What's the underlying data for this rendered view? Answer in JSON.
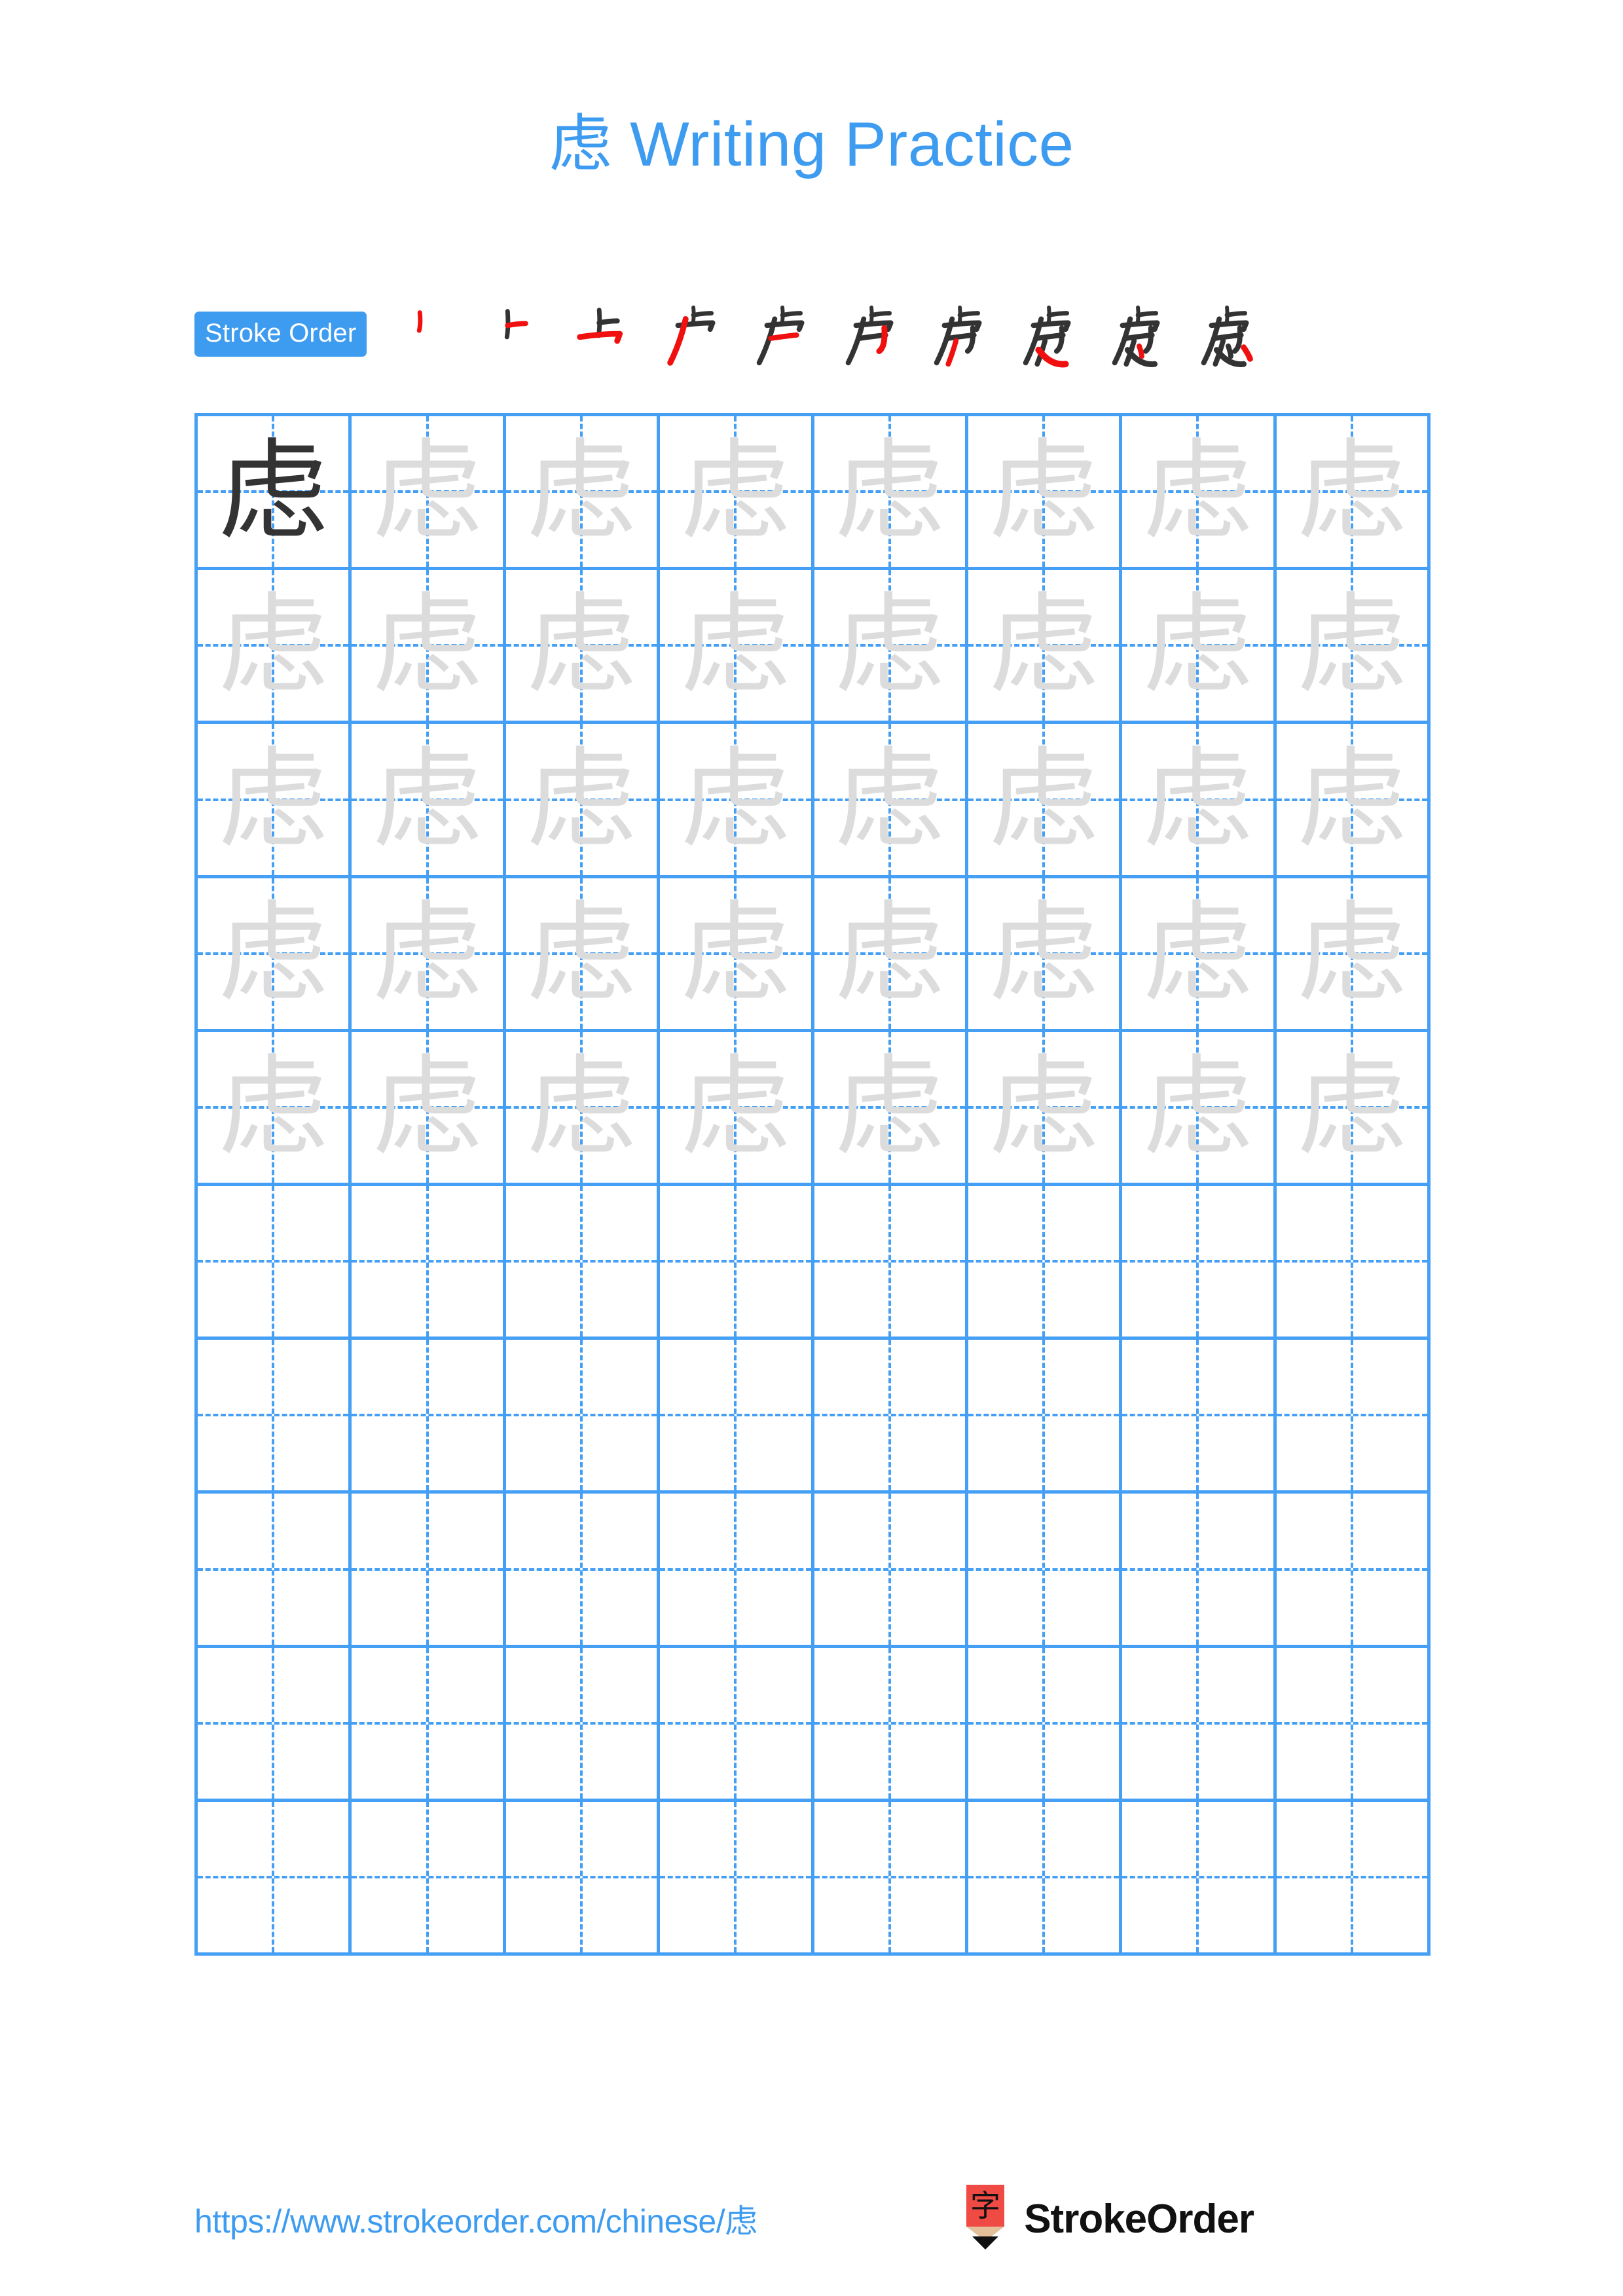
{
  "page": {
    "background": "#ffffff",
    "accent_blue": "#3d9bf0",
    "grid_blue": "#45a0f5",
    "dark_ink": "#333333",
    "faint_ink": "#dcdcdc",
    "stroke_highlight_red": "#f01010",
    "logo_red": "#ef4a43",
    "logo_tan": "#e3c09a"
  },
  "title": {
    "character": "虑",
    "text": " Writing Practice",
    "full": "虑 Writing Practice"
  },
  "stroke_order": {
    "badge_label": "Stroke Order",
    "character": "虑",
    "total_strokes": 10,
    "steps": [
      {
        "index": 1,
        "partial": "丶",
        "new_stroke": "dot"
      },
      {
        "index": 2,
        "partial": "⺊",
        "new_stroke": "horizontal"
      },
      {
        "index": 3,
        "partial": "上",
        "new_stroke": "horizontal"
      },
      {
        "index": 4,
        "partial": "广",
        "new_stroke": "left-falling"
      },
      {
        "index": 5,
        "partial": "卢",
        "new_stroke": "horizontal"
      },
      {
        "index": 6,
        "partial": "虍",
        "new_stroke": "vertical-hook"
      },
      {
        "index": 7,
        "partial": "虍",
        "new_stroke": "left-falling"
      },
      {
        "index": 8,
        "partial": "虑",
        "new_stroke": "slanted-hook"
      },
      {
        "index": 9,
        "partial": "虑",
        "new_stroke": "dot"
      },
      {
        "index": 10,
        "partial": "虑",
        "new_stroke": "dot"
      }
    ]
  },
  "grid": {
    "character": "虑",
    "columns": 8,
    "rows": 10,
    "filled_rows": 5,
    "empty_rows": 5,
    "guide_style": "dashed-crosshair",
    "rows_data": [
      {
        "row": 1,
        "cells": [
          "dark",
          "faint",
          "faint",
          "faint",
          "faint",
          "faint",
          "faint",
          "faint"
        ]
      },
      {
        "row": 2,
        "cells": [
          "faint",
          "faint",
          "faint",
          "faint",
          "faint",
          "faint",
          "faint",
          "faint"
        ]
      },
      {
        "row": 3,
        "cells": [
          "faint",
          "faint",
          "faint",
          "faint",
          "faint",
          "faint",
          "faint",
          "faint"
        ]
      },
      {
        "row": 4,
        "cells": [
          "faint",
          "faint",
          "faint",
          "faint",
          "faint",
          "faint",
          "faint",
          "faint"
        ]
      },
      {
        "row": 5,
        "cells": [
          "faint",
          "faint",
          "faint",
          "faint",
          "faint",
          "faint",
          "faint",
          "faint"
        ]
      },
      {
        "row": 6,
        "cells": [
          "blank",
          "blank",
          "blank",
          "blank",
          "blank",
          "blank",
          "blank",
          "blank"
        ]
      },
      {
        "row": 7,
        "cells": [
          "blank",
          "blank",
          "blank",
          "blank",
          "blank",
          "blank",
          "blank",
          "blank"
        ]
      },
      {
        "row": 8,
        "cells": [
          "blank",
          "blank",
          "blank",
          "blank",
          "blank",
          "blank",
          "blank",
          "blank"
        ]
      },
      {
        "row": 9,
        "cells": [
          "blank",
          "blank",
          "blank",
          "blank",
          "blank",
          "blank",
          "blank",
          "blank"
        ]
      },
      {
        "row": 10,
        "cells": [
          "blank",
          "blank",
          "blank",
          "blank",
          "blank",
          "blank",
          "blank",
          "blank"
        ]
      }
    ]
  },
  "footer": {
    "url": "https://www.strokeorder.com/chinese/虑",
    "brand_name": "StrokeOrder",
    "logo_character": "字"
  }
}
